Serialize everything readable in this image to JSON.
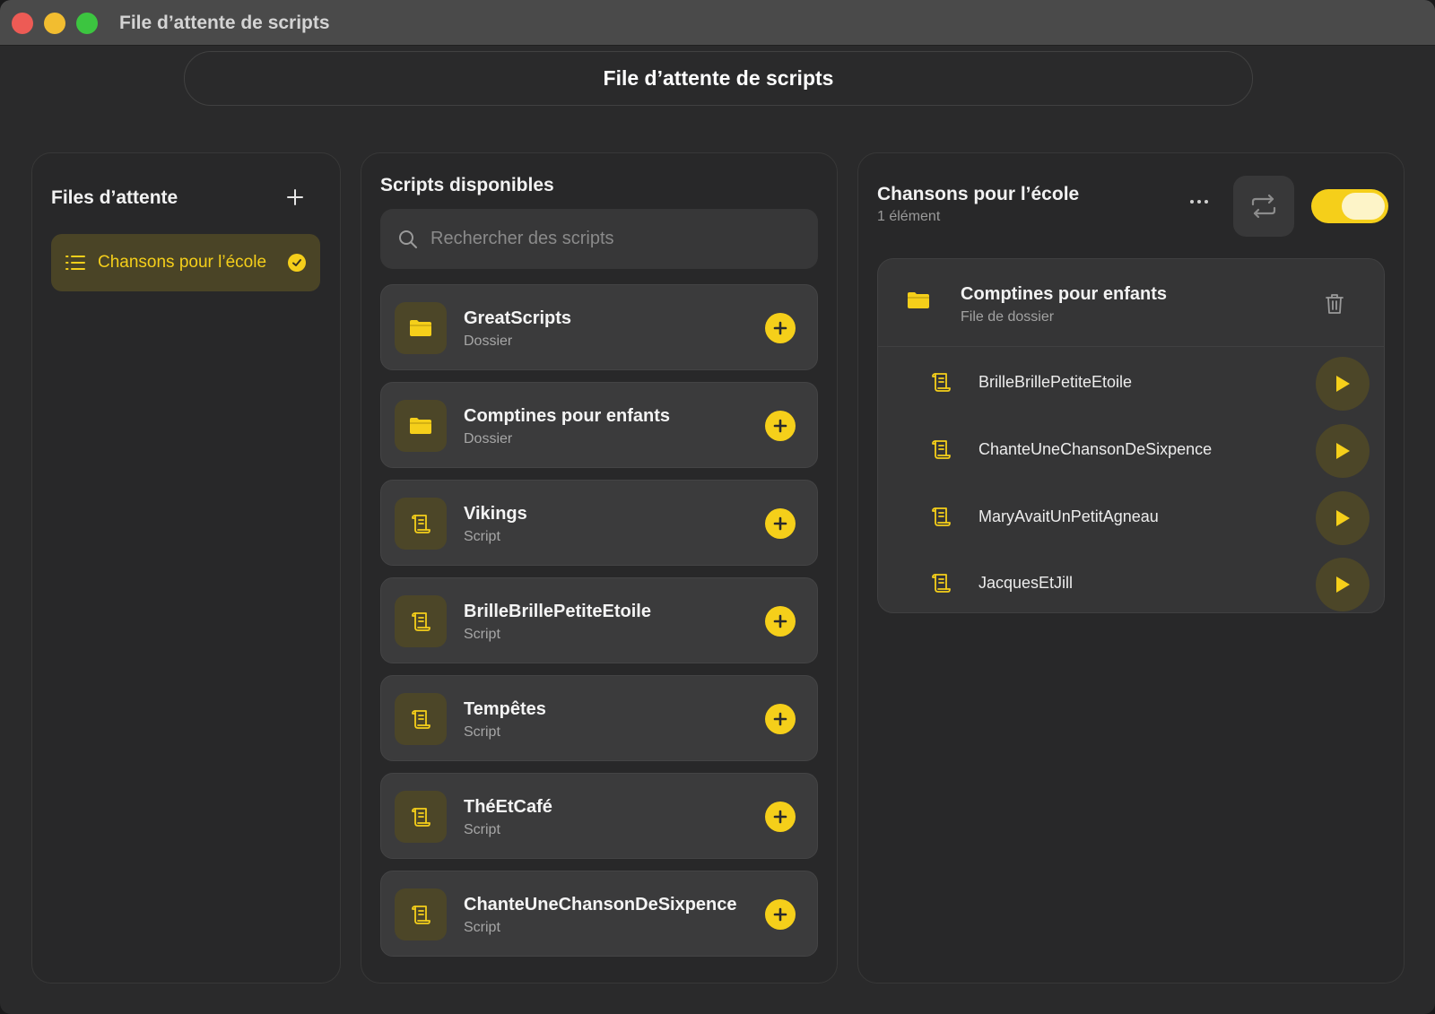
{
  "window": {
    "title": "File d’attente de scripts"
  },
  "header": {
    "title": "File d’attente de scripts"
  },
  "queues_panel": {
    "title": "Files d’attente",
    "items": [
      {
        "label": "Chansons pour l’école",
        "selected": true
      }
    ]
  },
  "scripts_panel": {
    "title": "Scripts disponibles",
    "search_placeholder": "Rechercher des scripts",
    "search_value": "",
    "items": [
      {
        "name": "GreatScripts",
        "type": "Dossier",
        "icon": "folder-icon"
      },
      {
        "name": "Comptines pour enfants",
        "type": "Dossier",
        "icon": "folder-icon"
      },
      {
        "name": "Vikings",
        "type": "Script",
        "icon": "scroll-icon"
      },
      {
        "name": "BrilleBrillePetiteEtoile",
        "type": "Script",
        "icon": "scroll-icon"
      },
      {
        "name": "Tempêtes",
        "type": "Script",
        "icon": "scroll-icon"
      },
      {
        "name": "ThéEtCafé",
        "type": "Script",
        "icon": "scroll-icon"
      },
      {
        "name": "ChanteUneChansonDeSixpence",
        "type": "Script",
        "icon": "scroll-icon"
      }
    ]
  },
  "queue_detail": {
    "title": "Chansons pour l’école",
    "subtitle": "1 élément",
    "repeat_enabled": true,
    "toggle_on": true,
    "group": {
      "name": "Comptines pour enfants",
      "subtitle": "File de dossier",
      "items": [
        {
          "name": "BrilleBrillePetiteEtoile"
        },
        {
          "name": "ChanteUneChansonDeSixpence"
        },
        {
          "name": "MaryAvaitUnPetitAgneau"
        },
        {
          "name": "JacquesEtJill"
        }
      ]
    }
  },
  "colors": {
    "accent": "#f5cf1a",
    "background": "#2a2a2b",
    "card": "#3b3b3c",
    "titlebar": "#4a4a4a"
  }
}
